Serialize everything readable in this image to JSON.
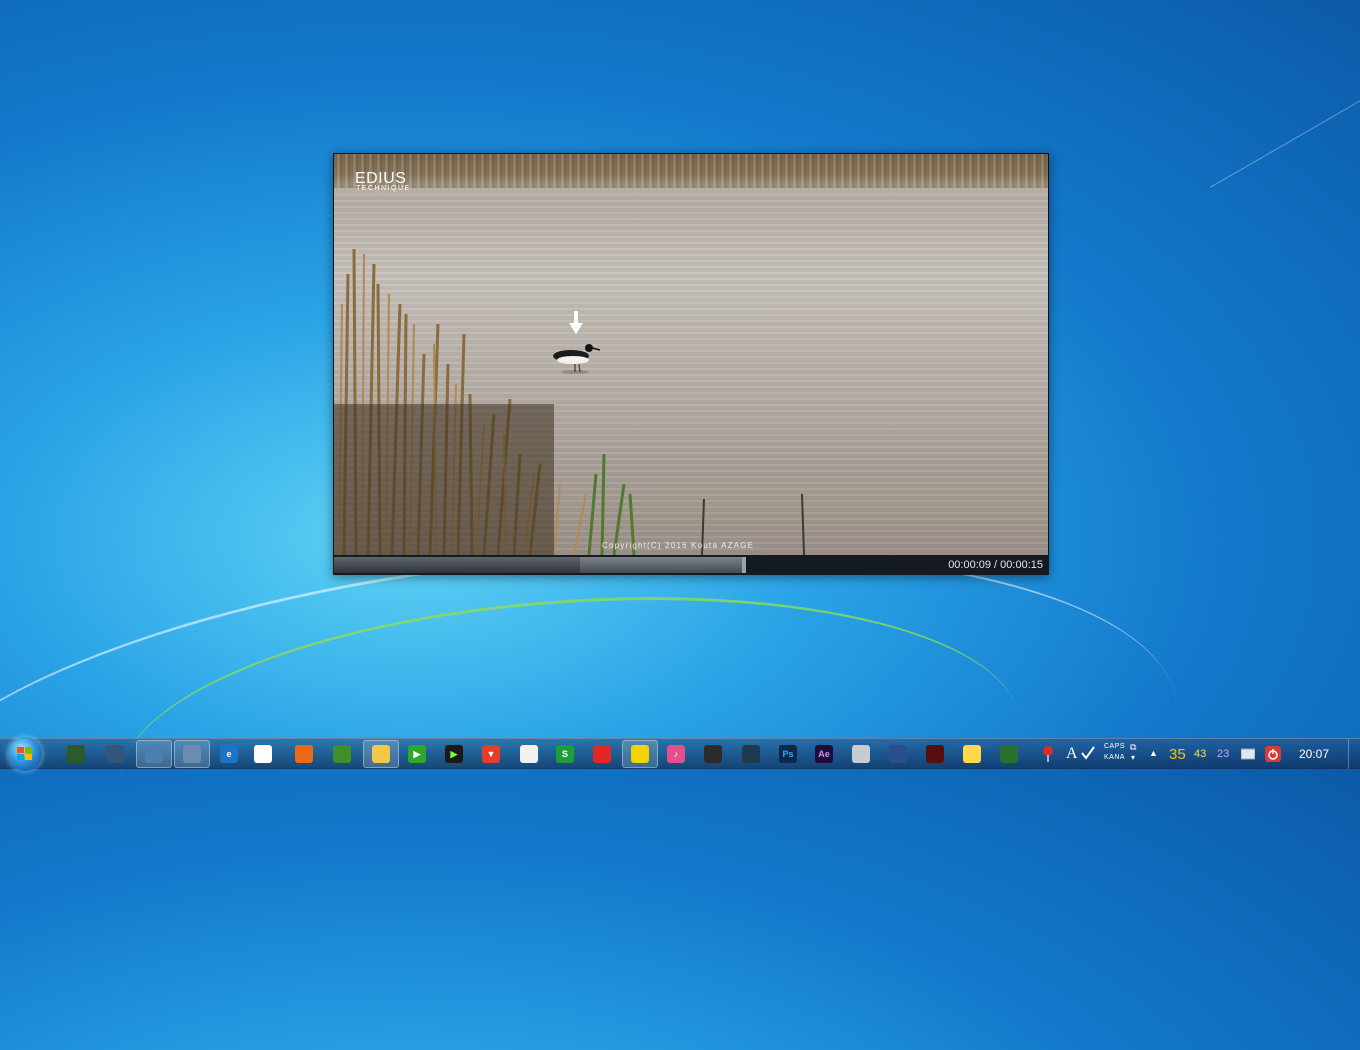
{
  "video": {
    "logo_main": "EDIUS",
    "logo_sub": "TECHNIQUE",
    "copyright": "Copyright(C)  2016 Kouta AZAGE"
  },
  "player": {
    "current_time": "00:00:09",
    "total_time": "00:00:15",
    "time_display": "00:00:09 / 00:00:15",
    "progress_fraction": 0.6
  },
  "taskbar": {
    "icons": [
      {
        "name": "app-icon-1",
        "label": ""
      },
      {
        "name": "remote-desktop-icon",
        "label": ""
      },
      {
        "name": "control-panel-icon",
        "label": ""
      },
      {
        "name": "explorer-window-icon",
        "label": ""
      },
      {
        "name": "internet-explorer-icon",
        "label": "e"
      },
      {
        "name": "chrome-icon",
        "label": ""
      },
      {
        "name": "firefox-icon",
        "label": ""
      },
      {
        "name": "edit-app-icon",
        "label": ""
      },
      {
        "name": "file-explorer-icon",
        "label": ""
      },
      {
        "name": "media-player-green-icon",
        "label": "▶"
      },
      {
        "name": "media-player-dark-icon",
        "label": "▶"
      },
      {
        "name": "vivaldi-like-icon",
        "label": "▼"
      },
      {
        "name": "notepad-icon",
        "label": ""
      },
      {
        "name": "spreadsheet-icon",
        "label": "S"
      },
      {
        "name": "red-app-icon",
        "label": ""
      },
      {
        "name": "video-editor-icon",
        "label": ""
      },
      {
        "name": "itunes-icon",
        "label": "♪"
      },
      {
        "name": "camera-app-icon",
        "label": ""
      },
      {
        "name": "globe-app-icon",
        "label": ""
      },
      {
        "name": "photoshop-icon",
        "label": "Ps"
      },
      {
        "name": "after-effects-icon",
        "label": "Ae"
      },
      {
        "name": "calculator-icon",
        "label": ""
      },
      {
        "name": "image-viewer-icon",
        "label": ""
      },
      {
        "name": "red-disc-icon",
        "label": ""
      },
      {
        "name": "paint-palette-icon",
        "label": ""
      },
      {
        "name": "search-magnifier-icon",
        "label": ""
      }
    ],
    "tray": {
      "ime_label": "A",
      "caps": "CAPS",
      "kana": "KANA",
      "stat_1": "35",
      "stat_2": "43",
      "stat_3": "23",
      "clock": "20:07"
    },
    "colors": {
      "stat_1": "#f5c400",
      "stat_2": "#ffe040",
      "stat_3": "#c9a0ff"
    }
  }
}
